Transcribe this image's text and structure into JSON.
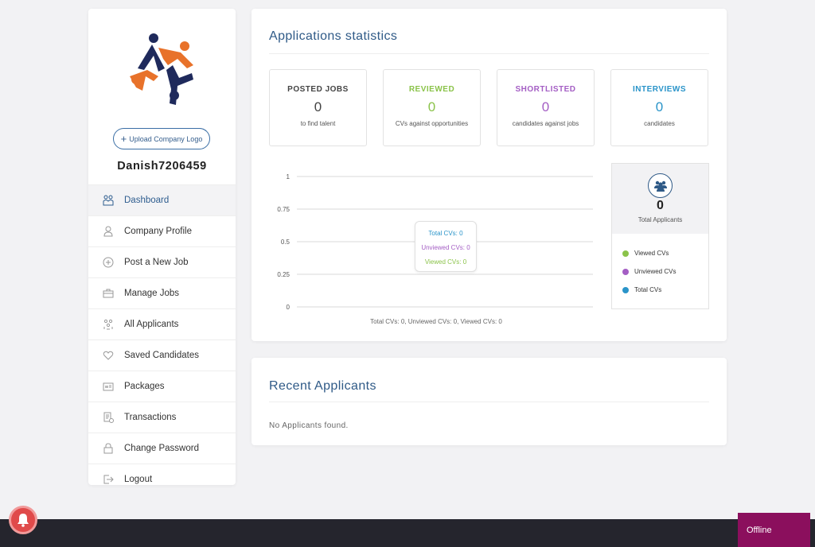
{
  "sidebar": {
    "upload_label": "Upload Company Logo",
    "company_name": "Danish7206459",
    "items": [
      {
        "label": "Dashboard",
        "icon": "dashboard-icon",
        "active": true
      },
      {
        "label": "Company Profile",
        "icon": "user-icon"
      },
      {
        "label": "Post a New Job",
        "icon": "plus-circle-icon"
      },
      {
        "label": "Manage Jobs",
        "icon": "briefcase-icon"
      },
      {
        "label": "All Applicants",
        "icon": "users-icon"
      },
      {
        "label": "Saved Candidates",
        "icon": "heart-icon"
      },
      {
        "label": "Packages",
        "icon": "package-icon"
      },
      {
        "label": "Transactions",
        "icon": "transactions-icon"
      },
      {
        "label": "Change Password",
        "icon": "lock-icon"
      },
      {
        "label": "Logout",
        "icon": "logout-icon"
      }
    ]
  },
  "stats": {
    "title": "Applications statistics",
    "boxes": [
      {
        "title": "POSTED JOBS",
        "value": "0",
        "sub": "to find talent",
        "color": "#444444"
      },
      {
        "title": "REVIEWED",
        "value": "0",
        "sub": "CVs against opportunities",
        "color": "#8bc34a"
      },
      {
        "title": "SHORTLISTED",
        "value": "0",
        "sub": "candidates against jobs",
        "color": "#a45ec4"
      },
      {
        "title": "INTERVIEWS",
        "value": "0",
        "sub": "candidates",
        "color": "#2a94c9"
      }
    ]
  },
  "chart_data": {
    "type": "line",
    "y_ticks": [
      "1",
      "0.75",
      "0.5",
      "0.25",
      "0"
    ],
    "ylim": [
      0,
      1
    ],
    "grid": true,
    "series": [
      {
        "name": "Total CVs",
        "values": [
          0
        ],
        "color": "#2a94c9"
      },
      {
        "name": "Unviewed CVs",
        "values": [
          0
        ],
        "color": "#a45ec4"
      },
      {
        "name": "Viewed CVs",
        "values": [
          0
        ],
        "color": "#8bc34a"
      }
    ],
    "tooltip": [
      "Total CVs: 0",
      "Unviewed CVs: 0",
      "Viewed CVs: 0"
    ],
    "caption": "Total CVs: 0, Unviewed CVs: 0, Viewed CVs: 0"
  },
  "legend": {
    "total_value": "0",
    "total_label": "Total Applicants",
    "icon": "users-icon",
    "items": [
      {
        "label": "Viewed CVs",
        "color": "#8bc34a"
      },
      {
        "label": "Unviewed CVs",
        "color": "#a45ec4"
      },
      {
        "label": "Total CVs",
        "color": "#2a94c9"
      }
    ]
  },
  "recent": {
    "title": "Recent Applicants",
    "empty": "No Applicants found."
  },
  "chat": {
    "status": "Offline"
  },
  "colors": {
    "accent": "#2f5a87",
    "offline_bg": "#8b0f5d",
    "footer_bg": "#25252d",
    "bell_bg": "#e04a4a"
  }
}
